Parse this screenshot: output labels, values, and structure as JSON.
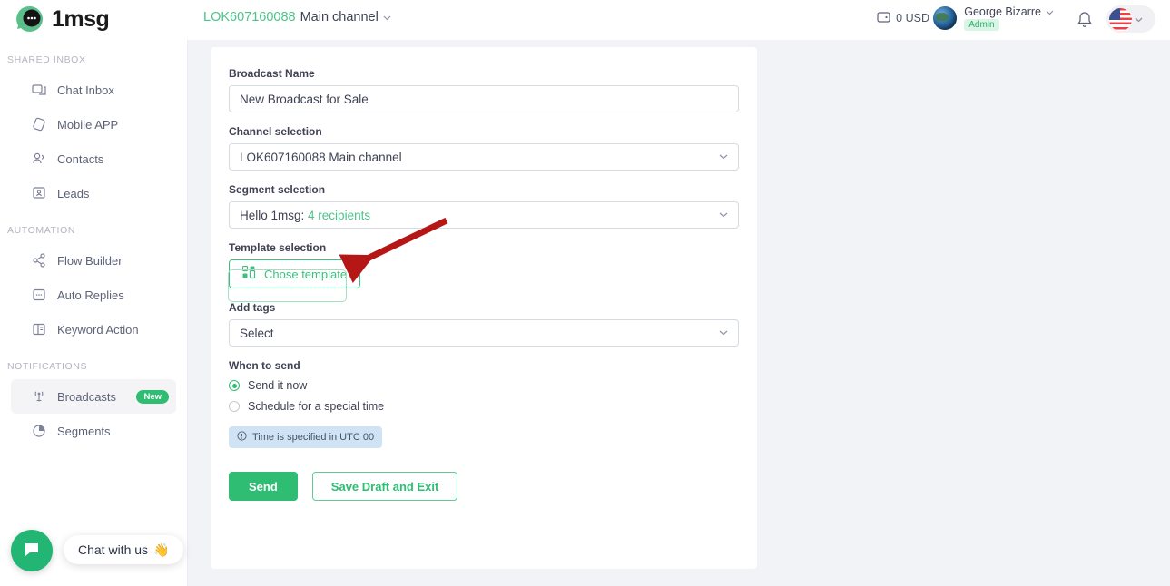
{
  "brand": {
    "name": "1msg",
    "logo_icon": "chat-bubble-logo-icon",
    "accent": "#2ebd72"
  },
  "header": {
    "channel_code": "LOK607160088",
    "channel_name": "Main channel",
    "channel_chevron_icon": "chevron-down-icon",
    "wallet_icon": "wallet-icon",
    "balance": "0 USD",
    "user_name": "George Bizarre",
    "user_role": "Admin",
    "user_chevron_icon": "chevron-down-icon",
    "avatar_icon": "earth-avatar",
    "bell_icon": "bell-icon",
    "flag_icon": "us-flag-icon",
    "flag_chevron_icon": "chevron-down-icon"
  },
  "sidebar": {
    "sections": [
      {
        "title": "SHARED INBOX",
        "items": [
          {
            "label": "Chat Inbox",
            "icon": "chat-inbox-icon",
            "active": false
          },
          {
            "label": "Mobile APP",
            "icon": "mobile-app-icon",
            "active": false
          },
          {
            "label": "Contacts",
            "icon": "contacts-icon",
            "active": false
          },
          {
            "label": "Leads",
            "icon": "leads-icon",
            "active": false
          }
        ]
      },
      {
        "title": "AUTOMATION",
        "items": [
          {
            "label": "Flow Builder",
            "icon": "flow-builder-icon",
            "active": false
          },
          {
            "label": "Auto Replies",
            "icon": "auto-replies-icon",
            "active": false
          },
          {
            "label": "Keyword Action",
            "icon": "keyword-action-icon",
            "active": false
          }
        ]
      },
      {
        "title": "NOTIFICATIONS",
        "items": [
          {
            "label": "Broadcasts",
            "icon": "broadcast-tower-icon",
            "active": true,
            "badge": "New"
          },
          {
            "label": "Segments",
            "icon": "segments-pie-icon",
            "active": false
          }
        ]
      }
    ]
  },
  "chat_widget": {
    "button_icon": "chat-bubble-icon",
    "label": "Chat with us",
    "emoji": "👋"
  },
  "form": {
    "broadcast_name_label": "Broadcast Name",
    "broadcast_name_value": "New Broadcast for Sale",
    "channel_label": "Channel selection",
    "channel_value": "LOK607160088 Main channel",
    "segment_label": "Segment selection",
    "segment_value": "Hello 1msg:",
    "segment_recipients": "4 recipients",
    "template_label": "Template selection",
    "template_button": "Chose template",
    "template_icon": "grid-template-icon",
    "tags_label": "Add tags",
    "tags_value": "Select",
    "when_label": "When to send",
    "radio_now": "Send it now",
    "radio_schedule": "Schedule for a special time",
    "utc_notice": "Time is specified in UTC 00",
    "utc_icon": "info-circle-icon",
    "send_button": "Send",
    "draft_button": "Save Draft and Exit"
  },
  "annotation": {
    "arrow_color": "#b51616",
    "arrow_icon": "pointer-arrow"
  }
}
